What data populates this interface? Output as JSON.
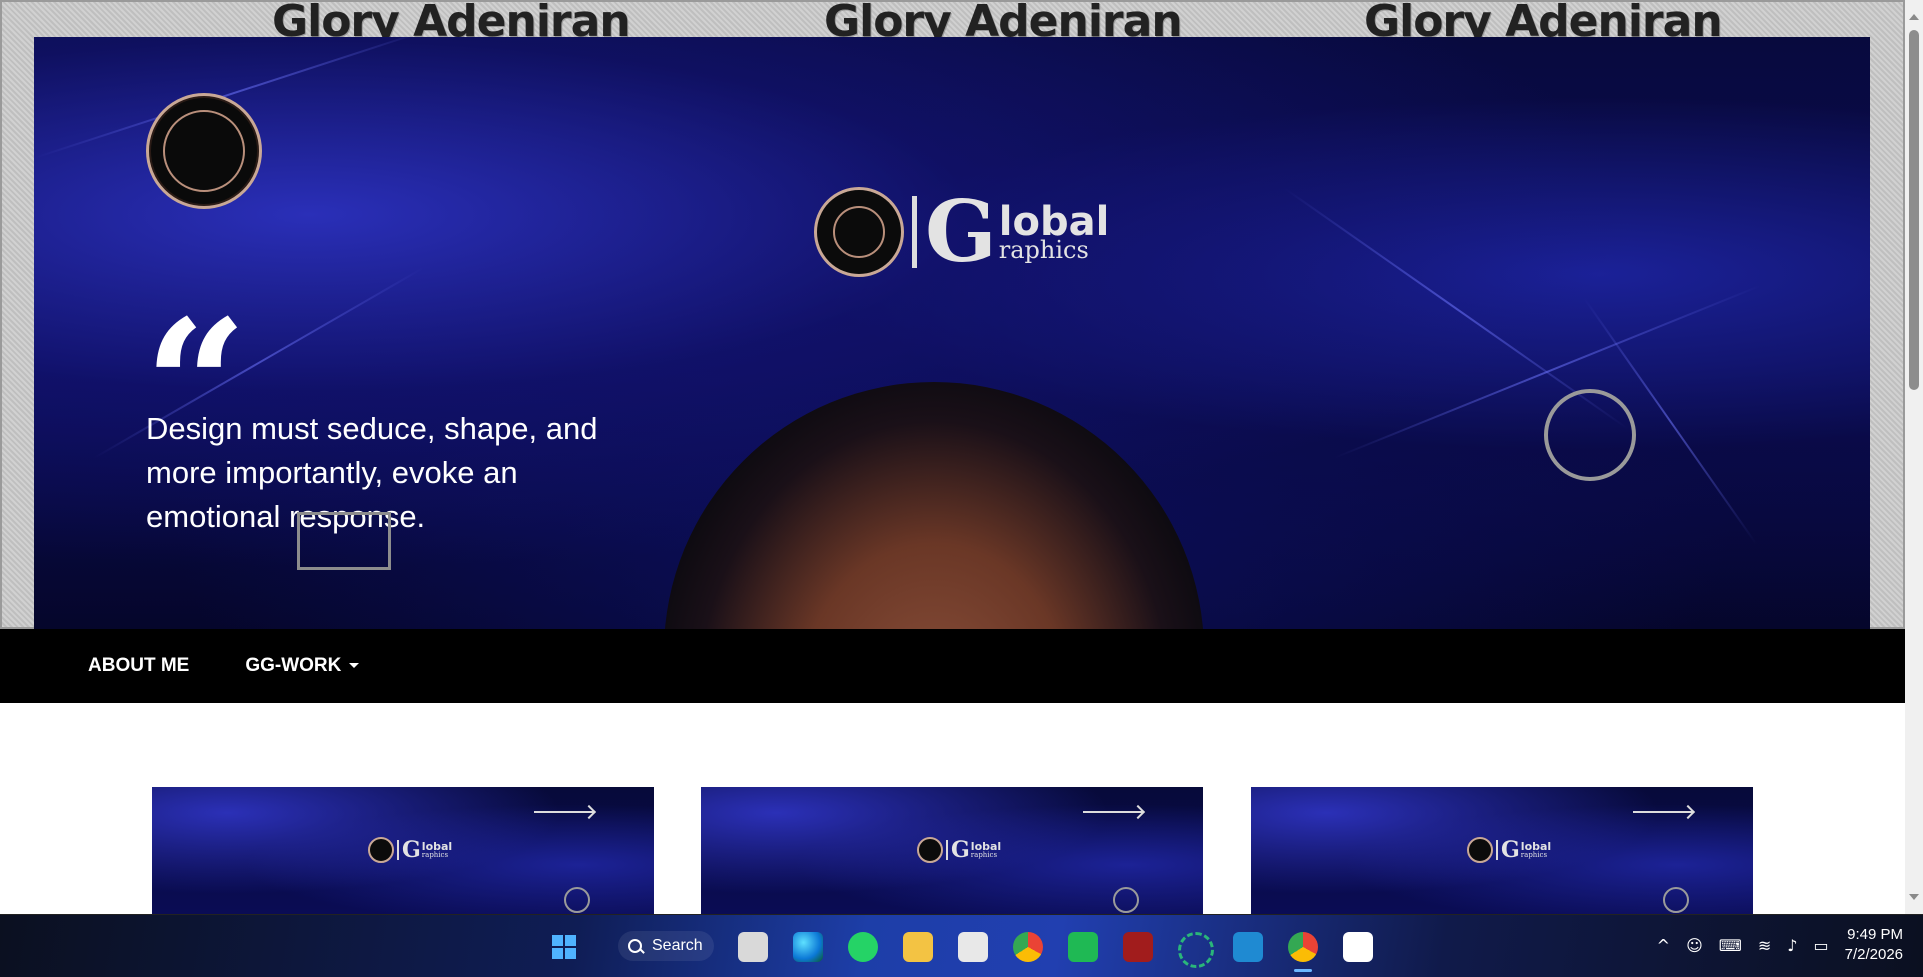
{
  "page": {
    "banner_names": [
      "Glory Adeniran",
      "Glory Adeniran",
      "Glory Adeniran"
    ],
    "brand": {
      "big_letter": "G",
      "word_top": "lobal",
      "word_bottom": "raphics"
    },
    "quote": {
      "mark": "“",
      "text": "Design must seduce, shape, and more importantly, evoke an emotional response."
    },
    "nav": {
      "items": [
        {
          "label": "ABOUT ME",
          "has_dropdown": false
        },
        {
          "label": "GG-WORK",
          "has_dropdown": true
        }
      ]
    },
    "cards": [
      {
        "brand_G": "G",
        "brand_t1": "lobal",
        "brand_t2": "raphics"
      },
      {
        "brand_G": "G",
        "brand_t1": "lobal",
        "brand_t2": "raphics"
      },
      {
        "brand_G": "G",
        "brand_t1": "lobal",
        "brand_t2": "raphics"
      }
    ],
    "accent_color": "#0a0c55"
  },
  "taskbar": {
    "search_label": "Search",
    "apps": [
      "windows-start-icon",
      "search-icon",
      "task-view-icon",
      "edge-icon",
      "whatsapp-icon",
      "file-explorer-icon",
      "microsoft-store-icon",
      "chrome-icon",
      "whatsapp-business-icon",
      "holy-bible-icon",
      "screen-recorder-icon",
      "vscode-icon",
      "chrome-profile-icon",
      "app-a-icon"
    ],
    "clock": {
      "time": "9:49 PM",
      "date": "7/2/2026"
    }
  }
}
